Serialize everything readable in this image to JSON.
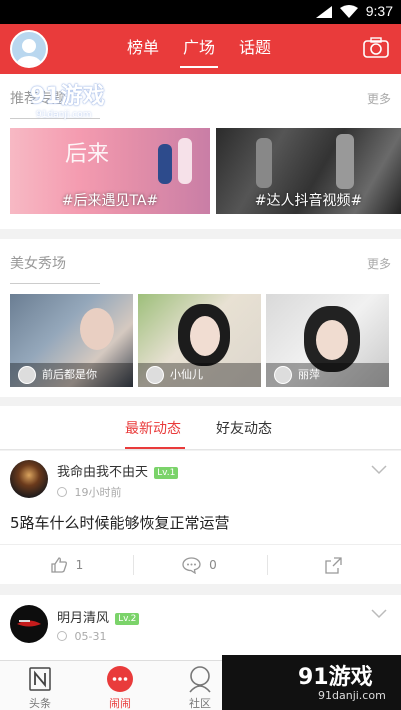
{
  "status_bar": {
    "time": "9:37"
  },
  "header": {
    "tabs": [
      {
        "label": "榜单"
      },
      {
        "label": "广场"
      },
      {
        "label": "话题"
      }
    ],
    "active_tab": "广场"
  },
  "recommend": {
    "title": "推荐专题",
    "more": "更多",
    "topics": [
      {
        "caption": "#后来遇见TA#"
      },
      {
        "caption": "#达人抖音视频#"
      }
    ]
  },
  "beauty": {
    "title": "美女秀场",
    "more": "更多",
    "items": [
      {
        "name": "前后都是你"
      },
      {
        "name": "小仙儿"
      },
      {
        "name": "丽萍"
      }
    ]
  },
  "feed_tabs": [
    {
      "label": "最新动态"
    },
    {
      "label": "好友动态"
    }
  ],
  "posts": [
    {
      "username": "我命由我不由天",
      "level": "Lv.1",
      "time": "19小时前",
      "content": "5路车什么时候能够恢复正常运营",
      "likes": "1",
      "comments": "0"
    },
    {
      "username": "明月清风",
      "level": "Lv.2",
      "time": "05-31"
    }
  ],
  "bottom_nav": [
    {
      "label": "头条"
    },
    {
      "label": "闹闹"
    },
    {
      "label": "社区"
    }
  ],
  "watermark": {
    "brand": "91游戏",
    "domain": "91danji.com"
  },
  "colors": {
    "accent": "#e93b3b",
    "level_badge": "#7bd36a"
  }
}
